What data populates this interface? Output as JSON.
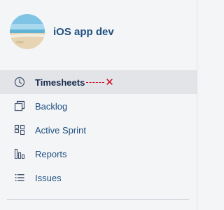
{
  "project": {
    "name": "iOS app dev",
    "avatar": "beach-photo"
  },
  "nav": {
    "items": [
      {
        "label": "Timesheets",
        "icon": "clock-icon",
        "active": true
      },
      {
        "label": "Backlog",
        "icon": "backlog-icon",
        "active": false
      },
      {
        "label": "Active Sprint",
        "icon": "board-icon",
        "active": false
      },
      {
        "label": "Reports",
        "icon": "reports-icon",
        "active": false
      },
      {
        "label": "Issues",
        "icon": "issues-list-icon",
        "active": false
      }
    ]
  },
  "annotation": {
    "mark": "✕",
    "color": "#d0021b"
  },
  "colors": {
    "link": "#205081",
    "active_text": "#172b4d",
    "active_bg": "#e2e4e8",
    "sidebar_bg": "#f4f5f7"
  }
}
